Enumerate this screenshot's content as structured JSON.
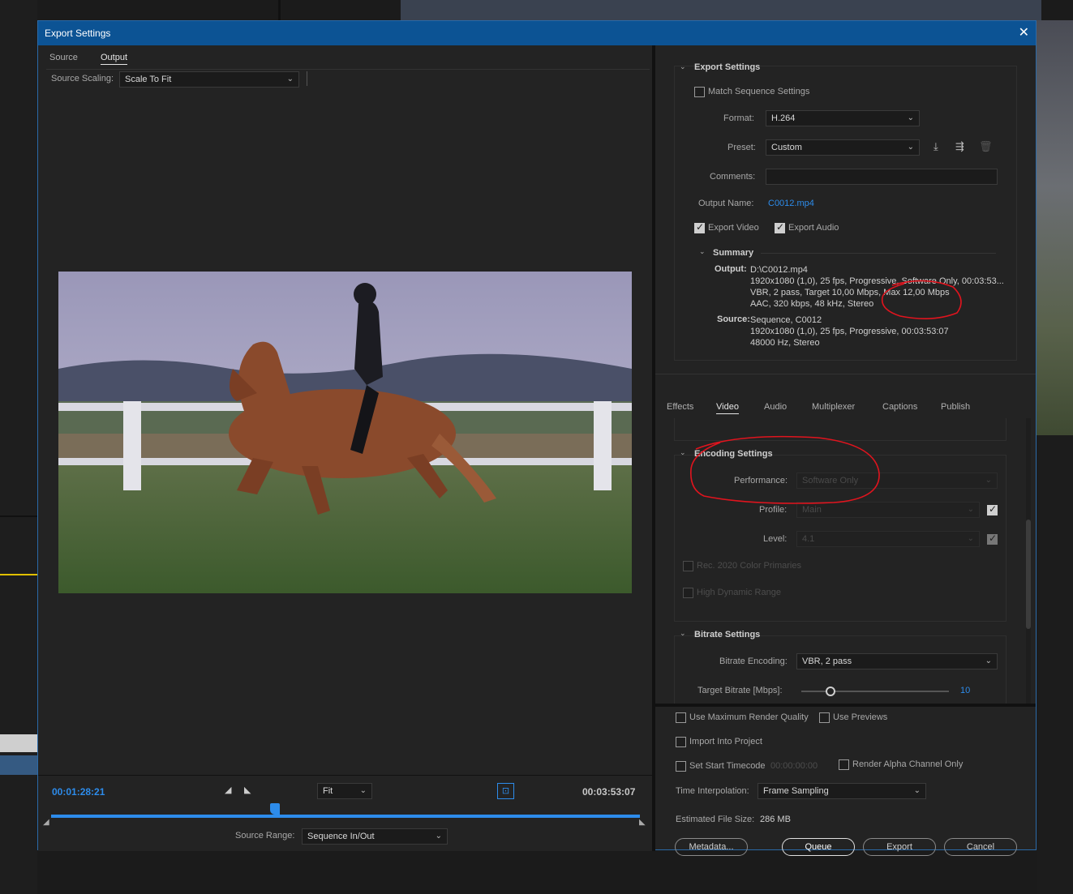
{
  "dialog": {
    "title": "Export Settings",
    "close_glyph": "✕"
  },
  "left": {
    "tabs": [
      "Source",
      "Output"
    ],
    "active_tab": "Output",
    "source_scaling_label": "Source Scaling:",
    "source_scaling_value": "Scale To Fit",
    "timecode_current": "00:01:28:21",
    "timecode_end": "00:03:53:07",
    "zoom_value": "Fit",
    "playhead_fraction": 0.38,
    "source_range_label": "Source Range:",
    "source_range_value": "Sequence In/Out"
  },
  "export_settings": {
    "heading": "Export Settings",
    "match_sequence_label": "Match Sequence Settings",
    "format_label": "Format:",
    "format_value": "H.264",
    "preset_label": "Preset:",
    "preset_value": "Custom",
    "comments_label": "Comments:",
    "comments_value": "",
    "output_name_label": "Output Name:",
    "output_name_value": "C0012.mp4",
    "export_video_label": "Export Video",
    "export_audio_label": "Export Audio",
    "summary_heading": "Summary",
    "output_label": "Output:",
    "output_lines": [
      "D:\\C0012.mp4",
      "1920x1080 (1,0), 25 fps, Progressive, Software Only, 00:03:53...",
      "VBR, 2 pass, Target 10,00 Mbps, Max 12,00 Mbps",
      "AAC, 320 kbps, 48 kHz, Stereo"
    ],
    "source_label": "Source:",
    "source_lines": [
      "Sequence, C0012",
      "1920x1080 (1,0), 25 fps, Progressive, 00:03:53:07",
      "48000 Hz, Stereo"
    ]
  },
  "tabs2": [
    "Effects",
    "Video",
    "Audio",
    "Multiplexer",
    "Captions",
    "Publish"
  ],
  "active_tab2": "Video",
  "encoding": {
    "heading": "Encoding Settings",
    "performance_label": "Performance:",
    "performance_value": "Software Only",
    "profile_label": "Profile:",
    "profile_value": "Main",
    "level_label": "Level:",
    "level_value": "4.1",
    "rec2020_label": "Rec. 2020 Color Primaries",
    "hdr_label": "High Dynamic Range"
  },
  "bitrate": {
    "heading": "Bitrate Settings",
    "encoding_label": "Bitrate Encoding:",
    "encoding_value": "VBR, 2 pass",
    "target_label": "Target Bitrate [Mbps]:",
    "target_value": "10"
  },
  "bottom": {
    "max_render_label": "Use Maximum Render Quality",
    "use_previews_label": "Use Previews",
    "import_label": "Import Into Project",
    "start_tc_label": "Set Start Timecode",
    "start_tc_value": "00:00:00:00",
    "alpha_label": "Render Alpha Channel Only",
    "time_interp_label": "Time Interpolation:",
    "time_interp_value": "Frame Sampling",
    "file_size_label": "Estimated File Size:",
    "file_size_value": "286 MB",
    "metadata_btn": "Metadata...",
    "queue_btn": "Queue",
    "export_btn": "Export",
    "cancel_btn": "Cancel"
  },
  "colors": {
    "accent": "#2d8ceb",
    "titlebar": "#0c5394",
    "annotation": "#e0141e"
  }
}
